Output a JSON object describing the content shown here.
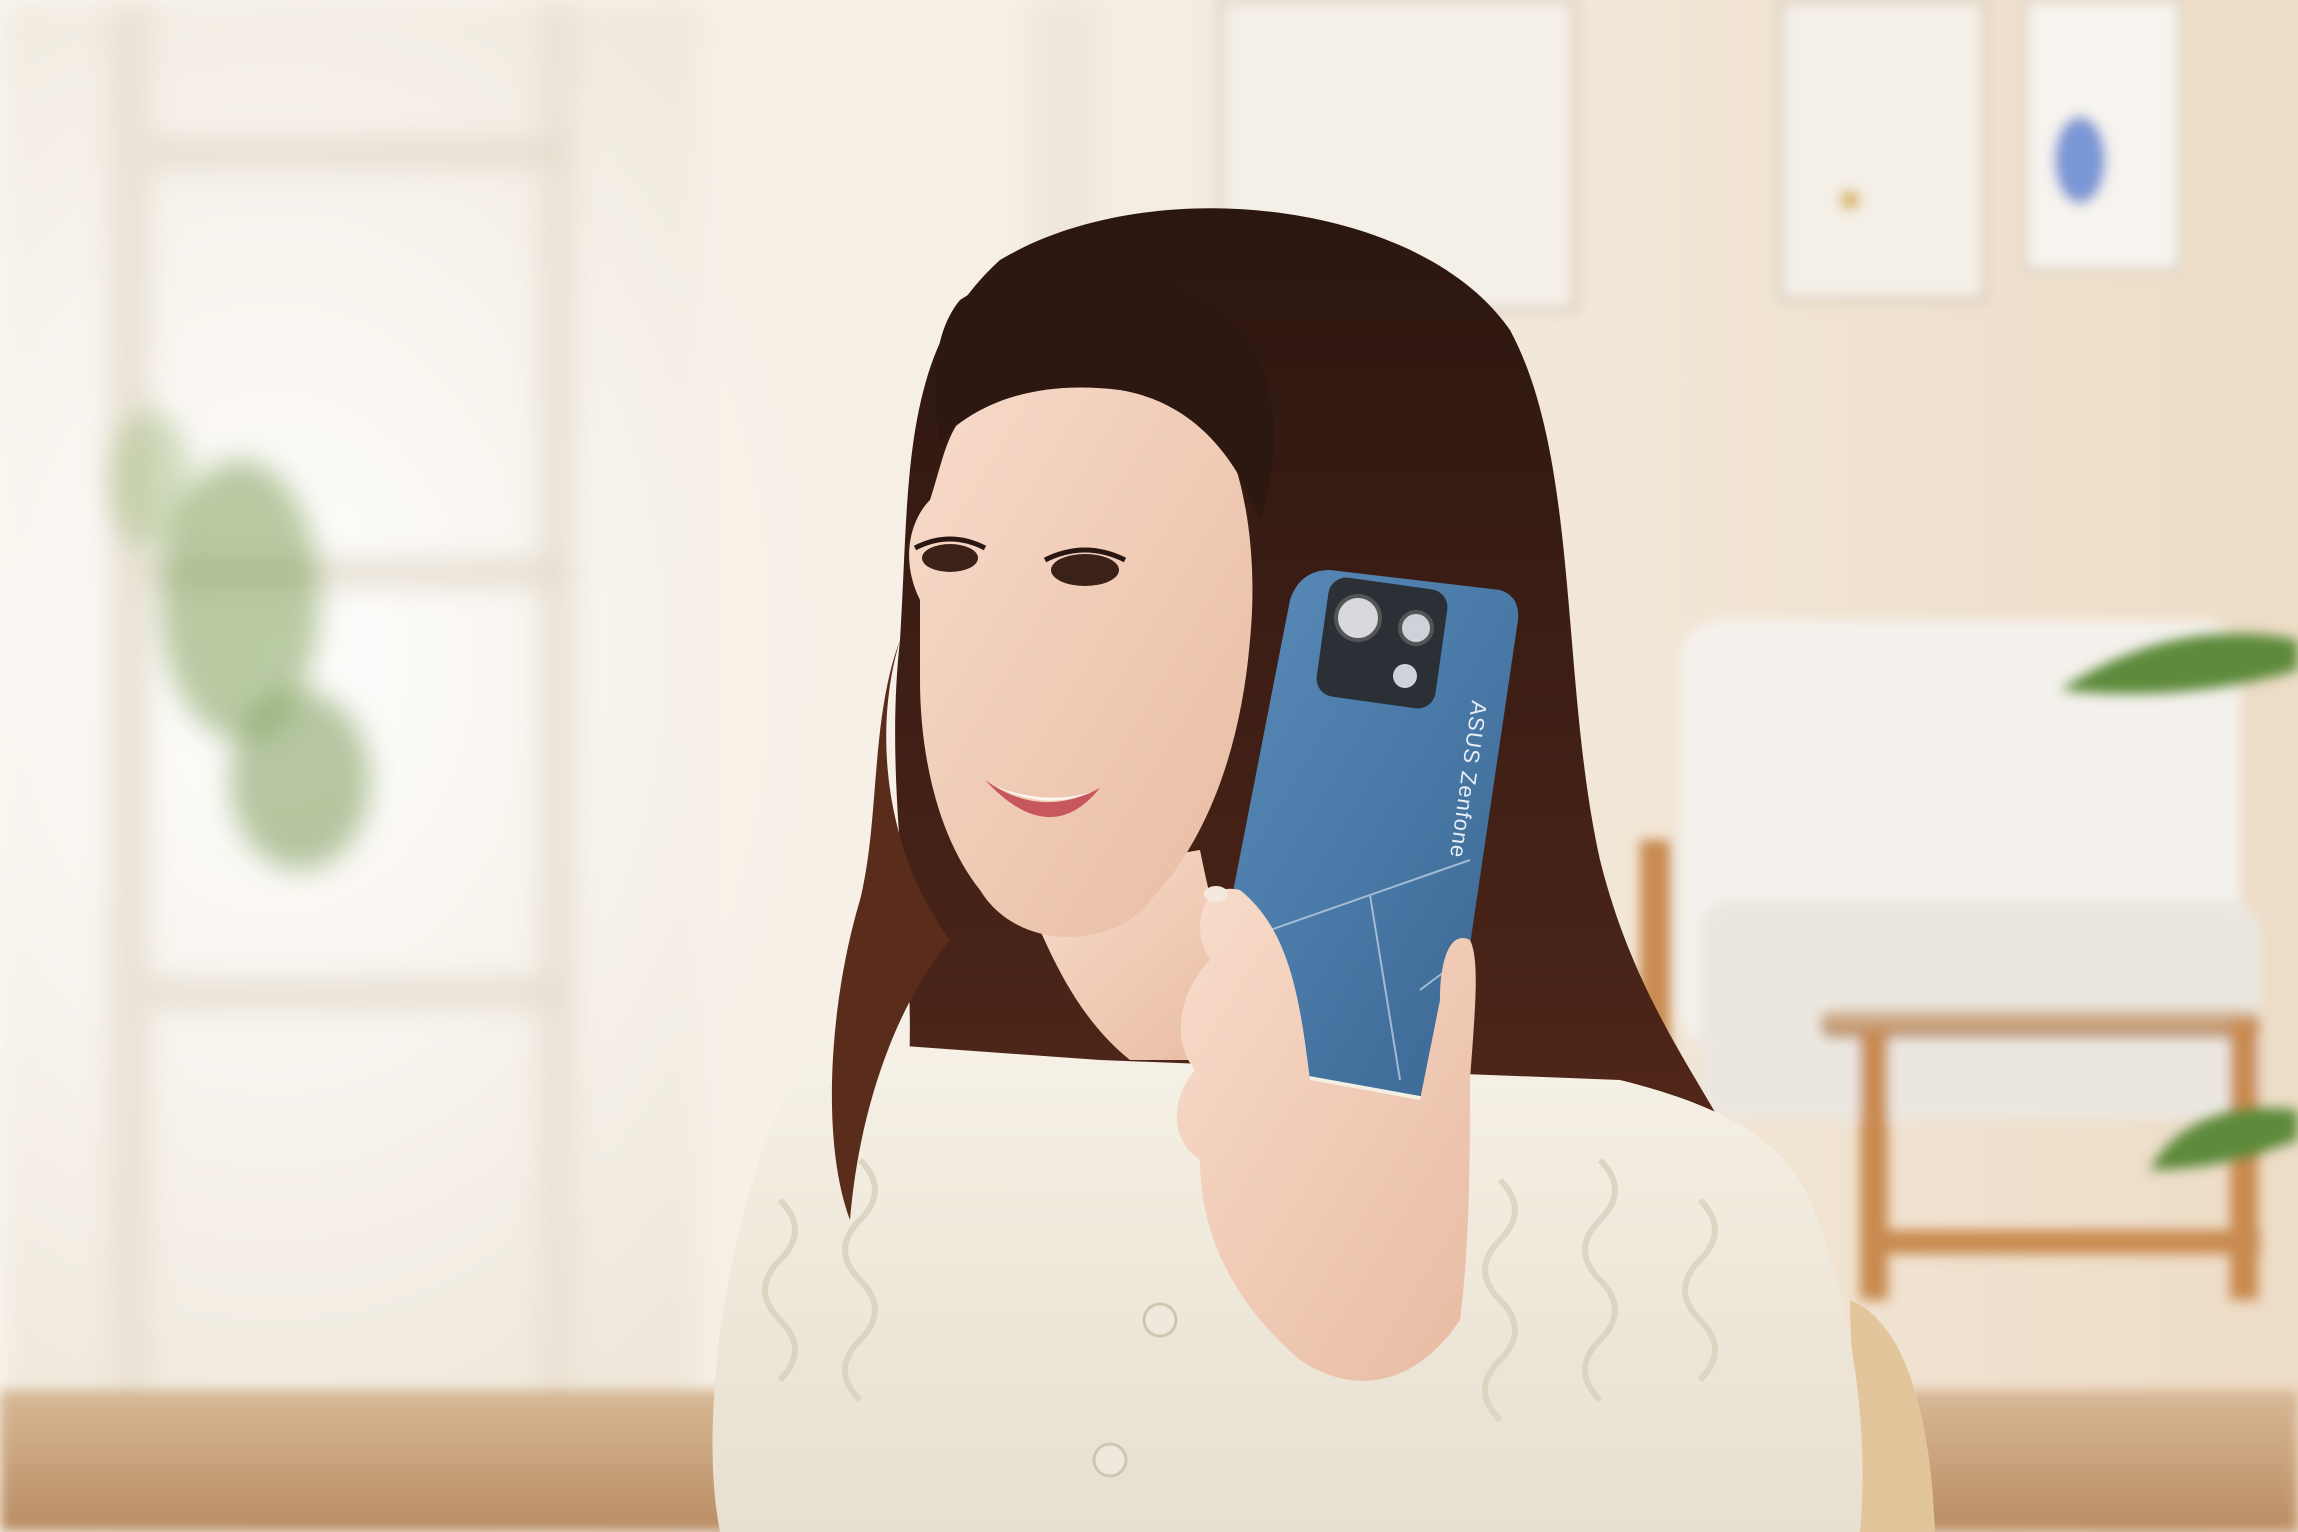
{
  "photo": {
    "phone": {
      "brand_text": "ASUS Zenfone",
      "color": "#4a7aa8"
    },
    "palette": {
      "wall": "#f1e6d8",
      "window_light": "#fbf8f2",
      "hair": "#3a1f16",
      "skin": "#f2cdb8",
      "top": "#f1ecdf",
      "chair_wood": "#c98a4f",
      "plant": "#5d8a3a"
    }
  }
}
